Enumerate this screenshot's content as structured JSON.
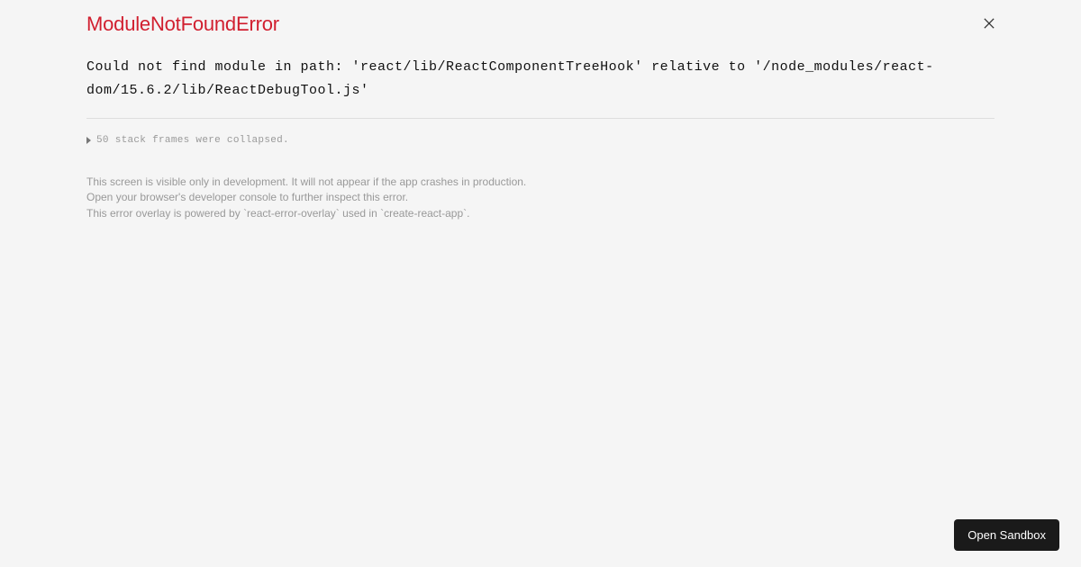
{
  "error": {
    "title": "ModuleNotFoundError",
    "message": "Could not find module in path: 'react/lib/ReactComponentTreeHook' relative to '/node_modules/react-dom/15.6.2/lib/ReactDebugTool.js'"
  },
  "stack": {
    "collapsed_label": "50 stack frames were collapsed."
  },
  "footer": {
    "line1": "This screen is visible only in development. It will not appear if the app crashes in production.",
    "line2": "Open your browser's developer console to further inspect this error.",
    "line3": "This error overlay is powered by `react-error-overlay` used in `create-react-app`."
  },
  "actions": {
    "open_sandbox_label": "Open Sandbox"
  }
}
